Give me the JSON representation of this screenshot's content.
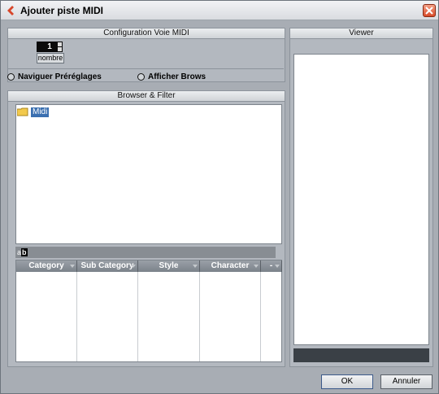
{
  "window": {
    "title": "Ajouter piste MIDI"
  },
  "config": {
    "header": "Configuration Voie MIDI",
    "count_value": "1",
    "count_label": "nombre",
    "radio_presets": "Naviguer Préréglages",
    "radio_browse": "Afficher Brows"
  },
  "browser": {
    "header": "Browser & Filter",
    "folder": "Midi",
    "filter_icon_a": "a",
    "filter_icon_b": "b",
    "columns": [
      "Category",
      "Sub Category",
      "Style",
      "Character",
      "-"
    ]
  },
  "viewer": {
    "header": "Viewer"
  },
  "buttons": {
    "ok": "OK",
    "cancel": "Annuler"
  },
  "colors": {
    "title_accent": "#d7462a",
    "selection": "#3a6fb0"
  }
}
